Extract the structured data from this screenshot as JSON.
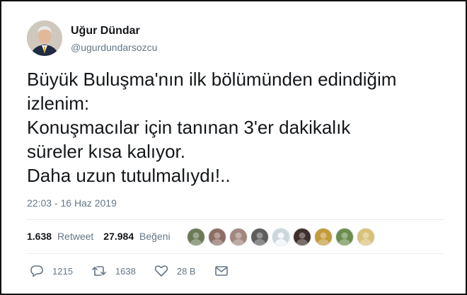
{
  "user": {
    "name": "Uğur Dündar",
    "handle": "@ugurdundarsozcu"
  },
  "tweet": {
    "lines": [
      "Büyük Buluşma'nın ilk bölümünden edindiğim",
      "izlenim:",
      "Konuşmacılar için tanınan 3'er dakikalık",
      "süreler kısa kalıyor.",
      "Daha uzun tutulmalıydı!.."
    ],
    "timestamp": "22:03 - 16 Haz 2019"
  },
  "stats": {
    "retweets_count": "1.638",
    "retweets_label": "Retweet",
    "likes_count": "27.984",
    "likes_label": "Beğeni"
  },
  "likers": [
    {
      "icon": "avatar-icon",
      "color": "#6b7a55"
    },
    {
      "icon": "avatar-icon",
      "color": "#8d6e63"
    },
    {
      "icon": "avatar-icon",
      "color": "#a1887f"
    },
    {
      "icon": "avatar-icon",
      "color": "#5d5d5d"
    },
    {
      "icon": "default-avatar-icon",
      "color": "#8899a6"
    },
    {
      "icon": "avatar-icon",
      "color": "#3e2f2a"
    },
    {
      "icon": "avatar-icon",
      "color": "#c49a3a"
    },
    {
      "icon": "avatar-icon",
      "color": "#6a8d4e"
    },
    {
      "icon": "avatar-icon",
      "color": "#d8c27a"
    }
  ],
  "actions": {
    "reply_count": "1215",
    "retweet_count": "1638",
    "like_count": "28 B"
  },
  "colors": {
    "text": "#14171a",
    "secondary": "#657786",
    "divider": "#e6ecf0"
  }
}
